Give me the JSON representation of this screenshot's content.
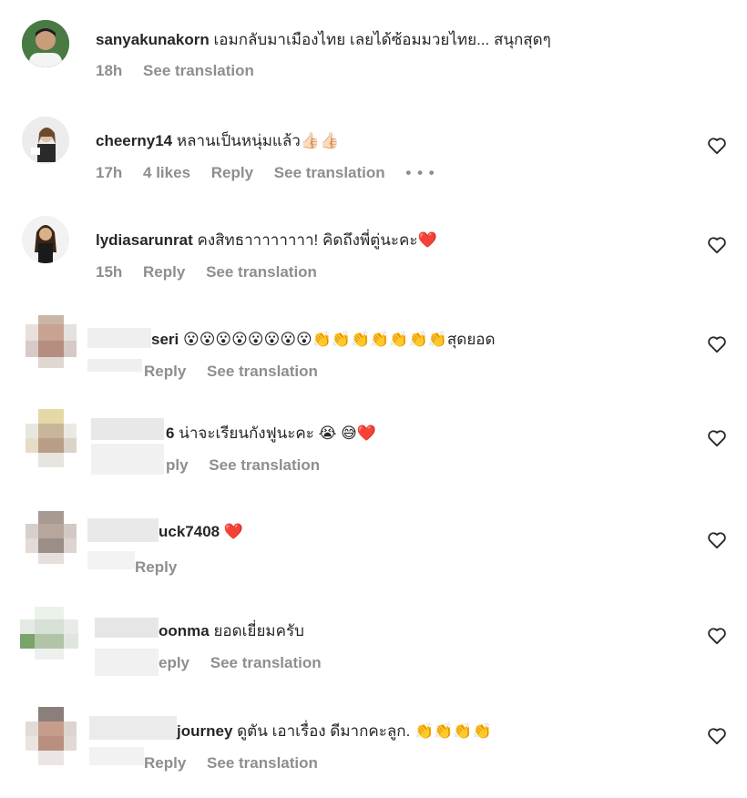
{
  "comments": [
    {
      "username": "sanyakunakorn",
      "message": "เอมกลับมาเมืองไทย เลยได้ซ้อมมวยไทย... สนุกสุดๆ",
      "time": "18h",
      "likes": "",
      "reply": "",
      "see_translation": "See translation",
      "has_heart": false,
      "has_more": false
    },
    {
      "username": "cheerny14",
      "message": "หลานเป็นหนุ่มแล้ว👍🏻👍🏻",
      "time": "17h",
      "likes": "4 likes",
      "reply": "Reply",
      "see_translation": "See translation",
      "has_heart": true,
      "has_more": true
    },
    {
      "username": "lydiasarunrat",
      "message": "คงสิทธาาาาาาาา! คิดถึงพี่ตู่นะคะ❤️",
      "time": "15h",
      "likes": "",
      "reply": "Reply",
      "see_translation": "See translation",
      "has_heart": true,
      "has_more": false
    },
    {
      "username": "seri",
      "message": "😮😮😮😮😮😮😮😮👏👏👏👏👏👏👏สุดยอด",
      "time": "",
      "likes": "",
      "reply": "Reply",
      "see_translation": "See translation",
      "has_heart": true,
      "has_more": false
    },
    {
      "username": "6",
      "message": "น่าจะเรียนกังฟูนะคะ 😭 😅❤️",
      "time": "",
      "likes": "",
      "reply": "ply",
      "see_translation": "See translation",
      "has_heart": true,
      "has_more": false
    },
    {
      "username": "uck7408",
      "message": "❤️",
      "time": "",
      "likes": "",
      "reply": "Reply",
      "see_translation": "",
      "has_heart": true,
      "has_more": false
    },
    {
      "username": "oonma",
      "message": "ยอดเยี่ยมครับ",
      "time": "",
      "likes": "",
      "reply": "eply",
      "see_translation": "See translation",
      "has_heart": true,
      "has_more": false
    },
    {
      "username": "journey",
      "message": "ดูตัน เอาเรื่อง ดีมากคะลูก. 👏👏👏👏",
      "time": "",
      "likes": "",
      "reply": "Reply",
      "see_translation": "See translation",
      "has_heart": true,
      "has_more": false
    }
  ],
  "icons": {
    "heart": "heart-outline-icon",
    "more": "more-dots-icon"
  },
  "colors": {
    "text": "#262626",
    "secondary": "#8e8e8e",
    "background": "#ffffff"
  }
}
